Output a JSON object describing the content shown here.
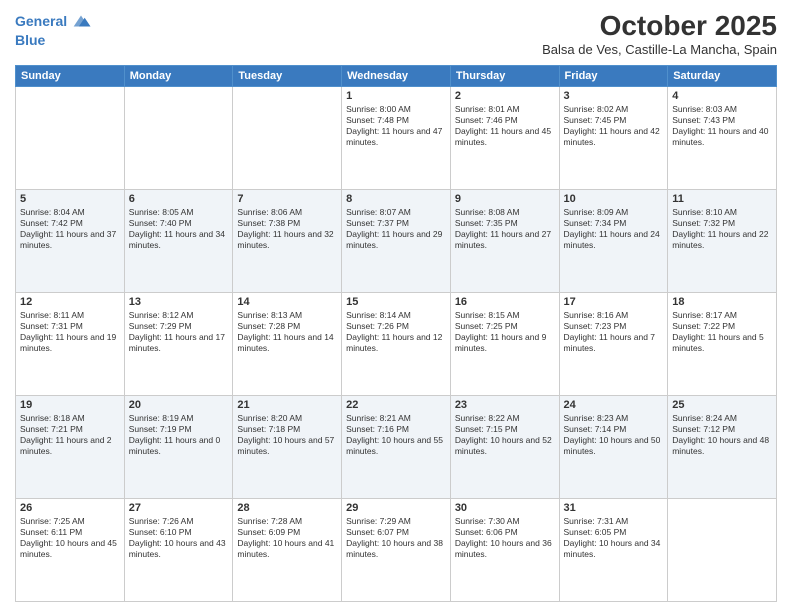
{
  "header": {
    "logo_line1": "General",
    "logo_line2": "Blue",
    "month_title": "October 2025",
    "location": "Balsa de Ves, Castille-La Mancha, Spain"
  },
  "days_of_week": [
    "Sunday",
    "Monday",
    "Tuesday",
    "Wednesday",
    "Thursday",
    "Friday",
    "Saturday"
  ],
  "rows": [
    [
      {
        "day": "",
        "text": ""
      },
      {
        "day": "",
        "text": ""
      },
      {
        "day": "",
        "text": ""
      },
      {
        "day": "1",
        "text": "Sunrise: 8:00 AM\nSunset: 7:48 PM\nDaylight: 11 hours and 47 minutes."
      },
      {
        "day": "2",
        "text": "Sunrise: 8:01 AM\nSunset: 7:46 PM\nDaylight: 11 hours and 45 minutes."
      },
      {
        "day": "3",
        "text": "Sunrise: 8:02 AM\nSunset: 7:45 PM\nDaylight: 11 hours and 42 minutes."
      },
      {
        "day": "4",
        "text": "Sunrise: 8:03 AM\nSunset: 7:43 PM\nDaylight: 11 hours and 40 minutes."
      }
    ],
    [
      {
        "day": "5",
        "text": "Sunrise: 8:04 AM\nSunset: 7:42 PM\nDaylight: 11 hours and 37 minutes."
      },
      {
        "day": "6",
        "text": "Sunrise: 8:05 AM\nSunset: 7:40 PM\nDaylight: 11 hours and 34 minutes."
      },
      {
        "day": "7",
        "text": "Sunrise: 8:06 AM\nSunset: 7:38 PM\nDaylight: 11 hours and 32 minutes."
      },
      {
        "day": "8",
        "text": "Sunrise: 8:07 AM\nSunset: 7:37 PM\nDaylight: 11 hours and 29 minutes."
      },
      {
        "day": "9",
        "text": "Sunrise: 8:08 AM\nSunset: 7:35 PM\nDaylight: 11 hours and 27 minutes."
      },
      {
        "day": "10",
        "text": "Sunrise: 8:09 AM\nSunset: 7:34 PM\nDaylight: 11 hours and 24 minutes."
      },
      {
        "day": "11",
        "text": "Sunrise: 8:10 AM\nSunset: 7:32 PM\nDaylight: 11 hours and 22 minutes."
      }
    ],
    [
      {
        "day": "12",
        "text": "Sunrise: 8:11 AM\nSunset: 7:31 PM\nDaylight: 11 hours and 19 minutes."
      },
      {
        "day": "13",
        "text": "Sunrise: 8:12 AM\nSunset: 7:29 PM\nDaylight: 11 hours and 17 minutes."
      },
      {
        "day": "14",
        "text": "Sunrise: 8:13 AM\nSunset: 7:28 PM\nDaylight: 11 hours and 14 minutes."
      },
      {
        "day": "15",
        "text": "Sunrise: 8:14 AM\nSunset: 7:26 PM\nDaylight: 11 hours and 12 minutes."
      },
      {
        "day": "16",
        "text": "Sunrise: 8:15 AM\nSunset: 7:25 PM\nDaylight: 11 hours and 9 minutes."
      },
      {
        "day": "17",
        "text": "Sunrise: 8:16 AM\nSunset: 7:23 PM\nDaylight: 11 hours and 7 minutes."
      },
      {
        "day": "18",
        "text": "Sunrise: 8:17 AM\nSunset: 7:22 PM\nDaylight: 11 hours and 5 minutes."
      }
    ],
    [
      {
        "day": "19",
        "text": "Sunrise: 8:18 AM\nSunset: 7:21 PM\nDaylight: 11 hours and 2 minutes."
      },
      {
        "day": "20",
        "text": "Sunrise: 8:19 AM\nSunset: 7:19 PM\nDaylight: 11 hours and 0 minutes."
      },
      {
        "day": "21",
        "text": "Sunrise: 8:20 AM\nSunset: 7:18 PM\nDaylight: 10 hours and 57 minutes."
      },
      {
        "day": "22",
        "text": "Sunrise: 8:21 AM\nSunset: 7:16 PM\nDaylight: 10 hours and 55 minutes."
      },
      {
        "day": "23",
        "text": "Sunrise: 8:22 AM\nSunset: 7:15 PM\nDaylight: 10 hours and 52 minutes."
      },
      {
        "day": "24",
        "text": "Sunrise: 8:23 AM\nSunset: 7:14 PM\nDaylight: 10 hours and 50 minutes."
      },
      {
        "day": "25",
        "text": "Sunrise: 8:24 AM\nSunset: 7:12 PM\nDaylight: 10 hours and 48 minutes."
      }
    ],
    [
      {
        "day": "26",
        "text": "Sunrise: 7:25 AM\nSunset: 6:11 PM\nDaylight: 10 hours and 45 minutes."
      },
      {
        "day": "27",
        "text": "Sunrise: 7:26 AM\nSunset: 6:10 PM\nDaylight: 10 hours and 43 minutes."
      },
      {
        "day": "28",
        "text": "Sunrise: 7:28 AM\nSunset: 6:09 PM\nDaylight: 10 hours and 41 minutes."
      },
      {
        "day": "29",
        "text": "Sunrise: 7:29 AM\nSunset: 6:07 PM\nDaylight: 10 hours and 38 minutes."
      },
      {
        "day": "30",
        "text": "Sunrise: 7:30 AM\nSunset: 6:06 PM\nDaylight: 10 hours and 36 minutes."
      },
      {
        "day": "31",
        "text": "Sunrise: 7:31 AM\nSunset: 6:05 PM\nDaylight: 10 hours and 34 minutes."
      },
      {
        "day": "",
        "text": ""
      }
    ]
  ]
}
